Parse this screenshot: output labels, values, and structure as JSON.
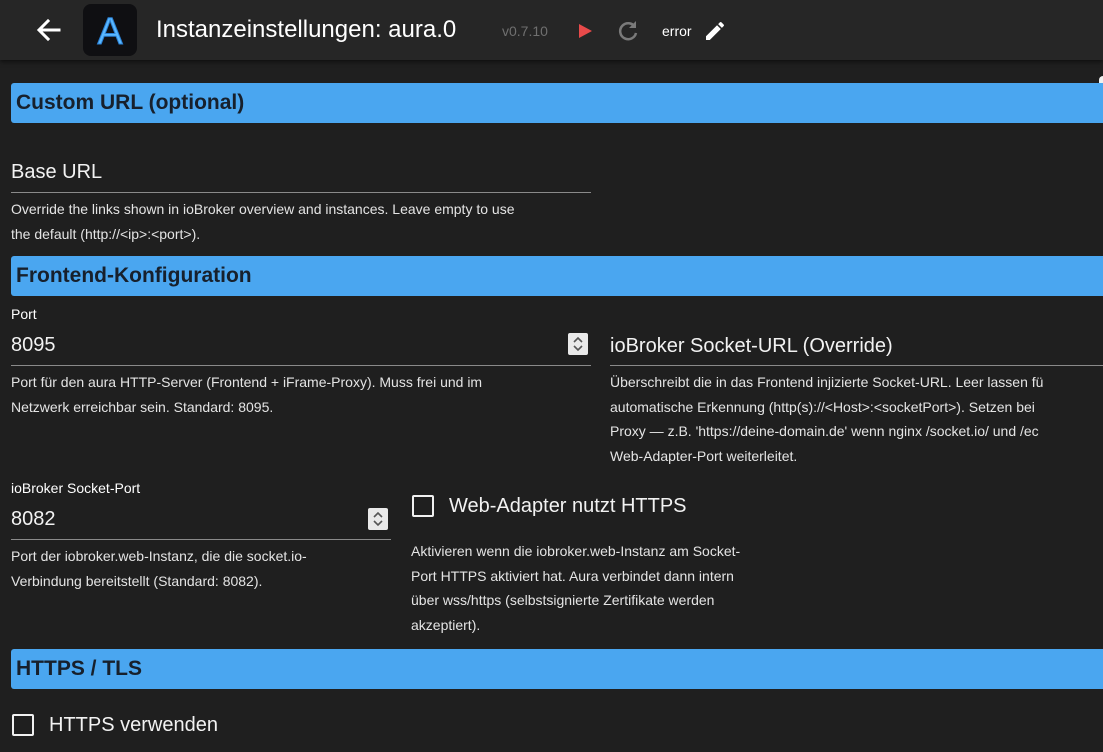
{
  "header": {
    "title": "Instanzeinstellungen: aura.0",
    "version": "v0.7.10",
    "status": "error",
    "logo_letter": "A"
  },
  "icons": {
    "back": "arrow-left-icon",
    "play": "play-icon",
    "reload": "reload-icon",
    "edit": "pencil-icon"
  },
  "colors": {
    "section_header": "#4aa6f0",
    "play": "#e84a4a",
    "background": "#1f1f1f",
    "topbar": "#262626"
  },
  "sections": {
    "custom_url": {
      "title": "Custom URL (optional)"
    },
    "frontend": {
      "title": "Frontend-Konfiguration"
    },
    "https": {
      "title": "HTTPS / TLS"
    }
  },
  "fields": {
    "base_url": {
      "placeholder": "Base URL",
      "help_lines": [
        "Override the links shown in ioBroker overview and instances. Leave empty to use",
        "the default (http://<ip>:<port>)."
      ]
    },
    "port": {
      "label": "Port",
      "value": "8095",
      "help_lines": [
        "Port für den aura HTTP-Server (Frontend + iFrame-Proxy). Muss frei und im",
        "Netzwerk erreichbar sein. Standard: 8095."
      ]
    },
    "socket_url": {
      "placeholder": "ioBroker Socket-URL (Override)",
      "help_lines": [
        "Überschreibt die in das Frontend injizierte Socket-URL. Leer lassen fü",
        "automatische Erkennung (http(s)://<Host>:<socketPort>). Setzen bei",
        "Proxy — z.B. 'https://deine-domain.de' wenn nginx /socket.io/ und /ec",
        "Web-Adapter-Port weiterleitet."
      ]
    },
    "socket_port": {
      "label": "ioBroker Socket-Port",
      "value": "8082",
      "help_lines": [
        "Port der iobroker.web-Instanz, die die socket.io-",
        "Verbindung bereitstellt (Standard: 8082)."
      ]
    },
    "web_https": {
      "label": "Web-Adapter nutzt HTTPS",
      "checked": false,
      "help_lines": [
        "Aktivieren wenn die iobroker.web-Instanz am Socket-",
        "Port HTTPS aktiviert hat. Aura verbindet dann intern",
        "über wss/https (selbstsignierte Zertifikate werden",
        "akzeptiert)."
      ]
    },
    "use_https": {
      "label": "HTTPS verwenden",
      "checked": false
    }
  }
}
